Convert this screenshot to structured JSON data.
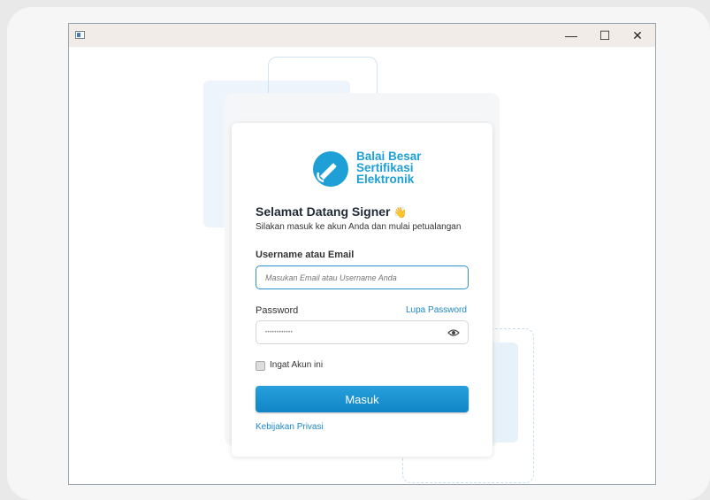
{
  "window": {
    "minimize_glyph": "—",
    "maximize_glyph": "☐",
    "close_glyph": "✕"
  },
  "brand": {
    "line1": "Balai Besar",
    "line2": "Sertifikasi",
    "line3": "Elektronik",
    "color": "#1e9fd6"
  },
  "login": {
    "title": "Selamat Datang Signer",
    "title_emoji": "👋",
    "subtitle": "Silakan masuk ke akun Anda dan mulai petualangan",
    "username_label": "Username atau Email",
    "username_placeholder": "Masukan Email atau Username Anda",
    "password_label": "Password",
    "forgot_password": "Lupa Password",
    "password_value": "••••••••••••",
    "remember_label": "Ingat Akun ini",
    "submit_label": "Masuk",
    "privacy_link": "Kebijakan Privasi"
  },
  "colors": {
    "accent": "#1e88c8",
    "button": "#1a93d3"
  }
}
